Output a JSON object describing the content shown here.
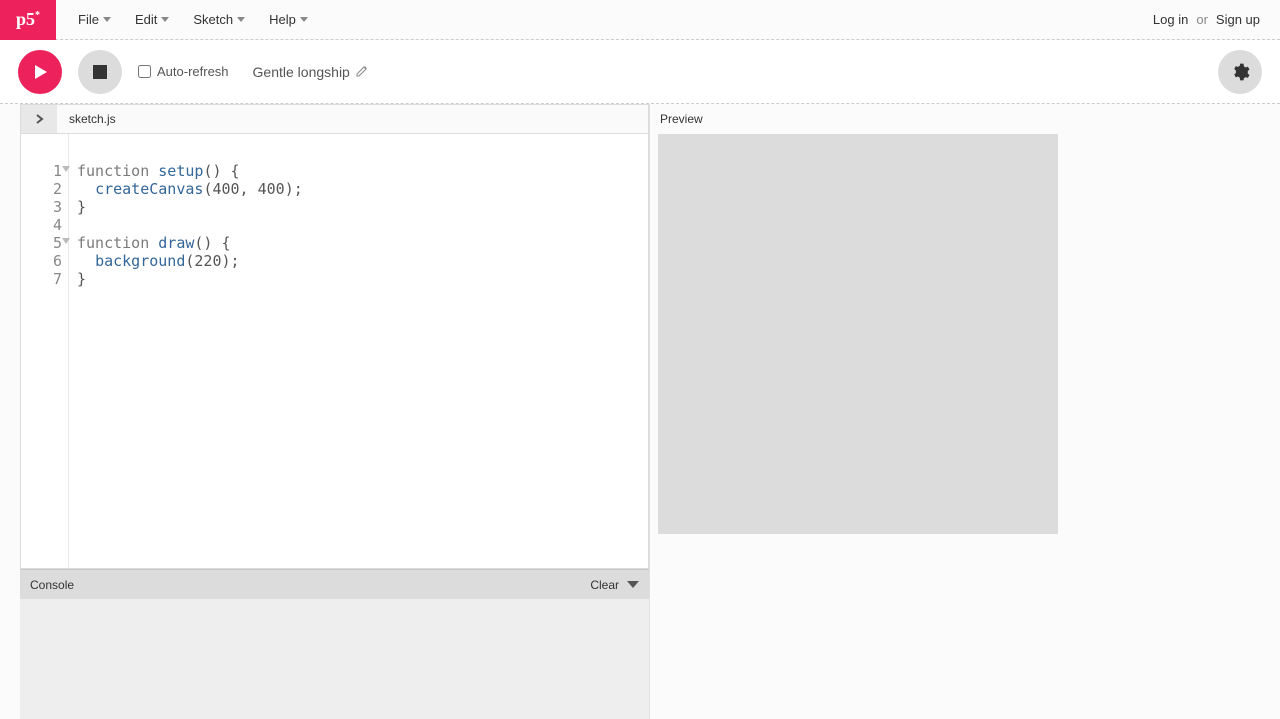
{
  "logo": "p5",
  "menu": {
    "file": "File",
    "edit": "Edit",
    "sketch": "Sketch",
    "help": "Help"
  },
  "auth": {
    "login": "Log in",
    "or": "or",
    "signup": "Sign up"
  },
  "toolbar": {
    "auto_refresh": "Auto-refresh",
    "sketch_name": "Gentle longship"
  },
  "tabs": {
    "filename": "sketch.js"
  },
  "editor": {
    "lines": [
      "1",
      "2",
      "3",
      "4",
      "5",
      "6",
      "7"
    ]
  },
  "code": {
    "l1a": "function ",
    "l1b": "setup",
    "l1c": "() {",
    "l2a": "  ",
    "l2b": "createCanvas",
    "l2c": "(400, 400);",
    "l3": "}",
    "l4": "",
    "l5a": "function ",
    "l5b": "draw",
    "l5c": "() {",
    "l6a": "  ",
    "l6b": "background",
    "l6c": "(220);",
    "l7": "}"
  },
  "preview": {
    "header": "Preview"
  },
  "console": {
    "title": "Console",
    "clear": "Clear"
  }
}
